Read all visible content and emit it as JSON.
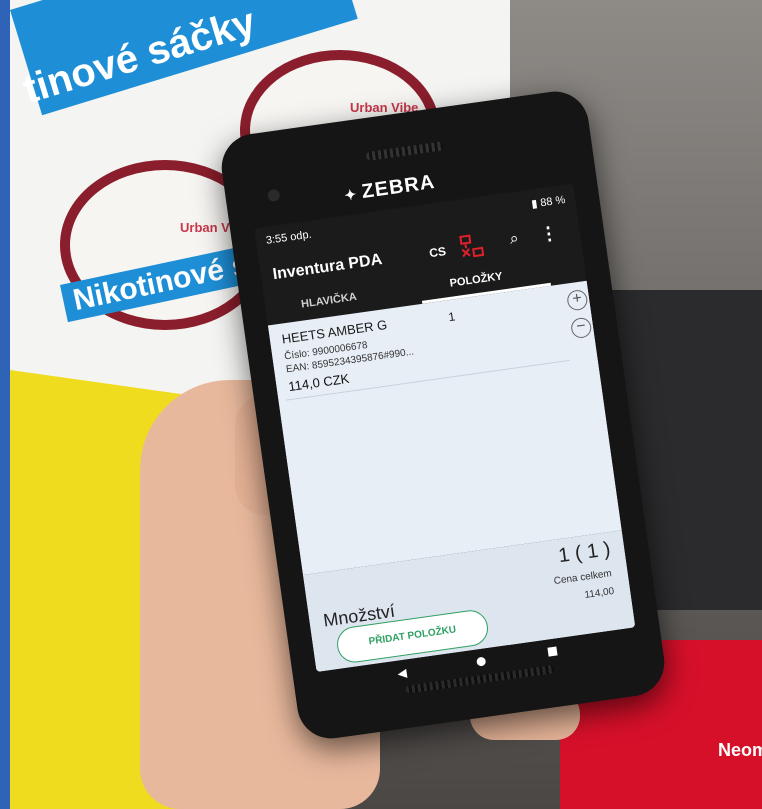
{
  "background": {
    "banner_text": "tinové sáčky",
    "shelf_label": "Nikotinové sáč",
    "tin_brand": "Urban Vibe",
    "red_card_text": "Neom"
  },
  "device": {
    "brand": "ZEBRA"
  },
  "statusbar": {
    "time": "3:55 odp.",
    "battery": "88 %"
  },
  "appbar": {
    "title": "Inventura PDA",
    "language": "CS",
    "icons": [
      "connection-status-icon",
      "search-icon",
      "more-vert-icon"
    ],
    "connection_color": "#e0202b"
  },
  "tabs": [
    {
      "label": "HLAVIČKA",
      "active": false
    },
    {
      "label": "POLOŽKY",
      "active": true
    }
  ],
  "items": [
    {
      "name": "HEETS AMBER  G",
      "qty": "1",
      "cislo": "Číslo: 9900006678",
      "ean": "EAN: 8595234395876#990...",
      "price": "114,0 CZK"
    }
  ],
  "footer": {
    "count": "1 ( 1 )",
    "mnozstvi_label": "Množství",
    "cena_label": "Cena celkem",
    "total": "114,00",
    "add_button": "PŘIDAT POLOŽKU",
    "accent": "#2fa063"
  }
}
